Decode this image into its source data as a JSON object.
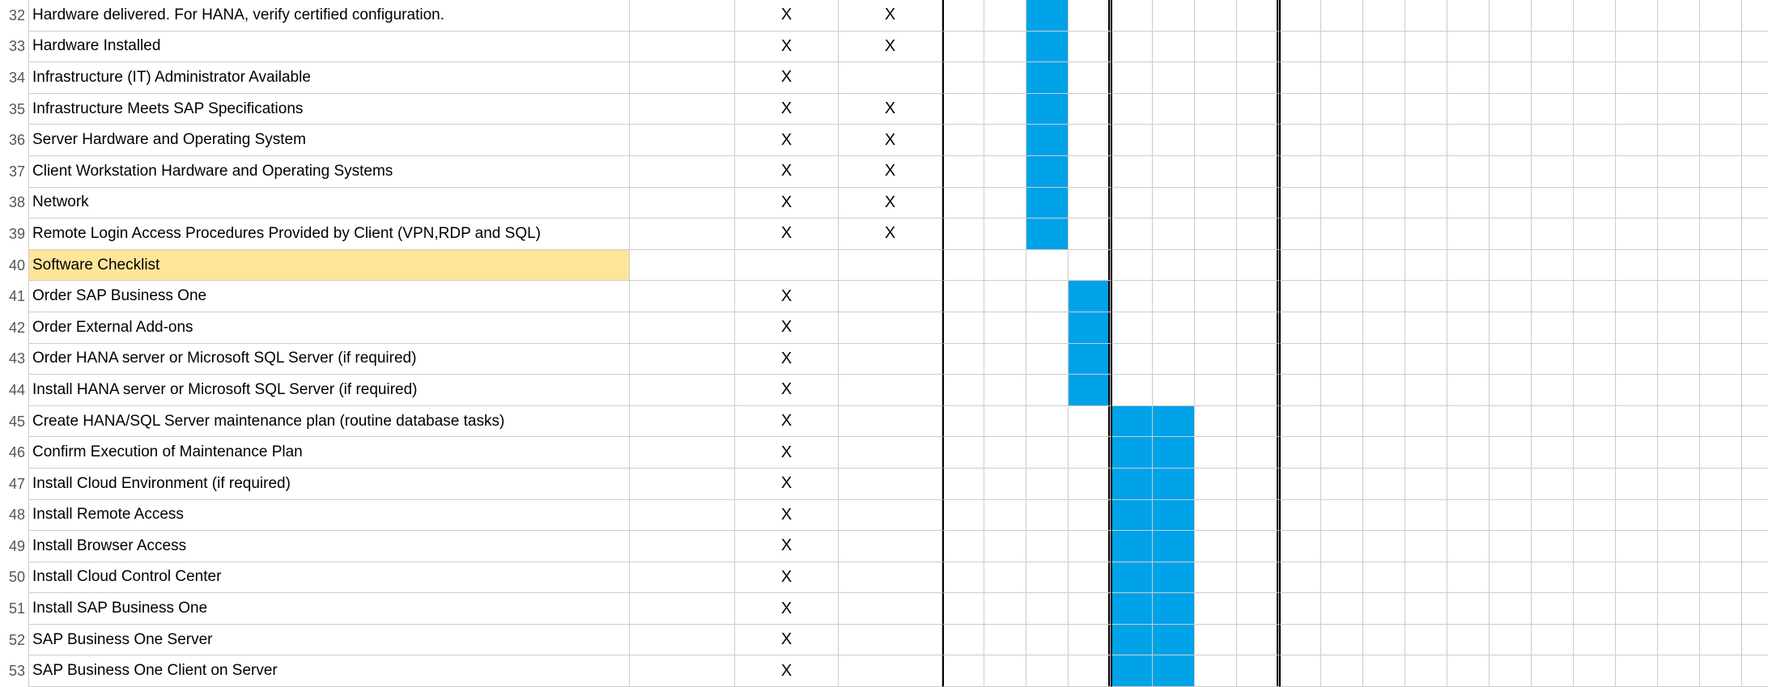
{
  "colors": {
    "accent": "#00a2e8",
    "section_bg": "#ffe599"
  },
  "gantt": {
    "columns": 20,
    "thick_divider_after_cols": [
      0,
      4,
      8
    ]
  },
  "rows": [
    {
      "num": 32,
      "task": "Hardware delivered. For HANA, verify certified configuration.",
      "x1": "X",
      "x2": "X",
      "bars": [
        3
      ]
    },
    {
      "num": 33,
      "task": "Hardware Installed",
      "x1": "X",
      "x2": "X",
      "bars": [
        3
      ]
    },
    {
      "num": 34,
      "task": "Infrastructure (IT) Administrator Available",
      "x1": "X",
      "x2": "",
      "bars": [
        3
      ]
    },
    {
      "num": 35,
      "task": "Infrastructure Meets SAP Specifications",
      "x1": "X",
      "x2": "X",
      "bars": [
        3
      ]
    },
    {
      "num": 36,
      "task": "Server Hardware and Operating System",
      "x1": "X",
      "x2": "X",
      "bars": [
        3
      ]
    },
    {
      "num": 37,
      "task": "Client Workstation Hardware and Operating Systems",
      "x1": "X",
      "x2": "X",
      "bars": [
        3
      ]
    },
    {
      "num": 38,
      "task": "Network",
      "x1": "X",
      "x2": "X",
      "bars": [
        3
      ]
    },
    {
      "num": 39,
      "task": "Remote Login Access Procedures Provided by Client (VPN,RDP and SQL)",
      "x1": "X",
      "x2": "X",
      "bars": [
        3
      ]
    },
    {
      "num": 40,
      "task": "Software Checklist",
      "x1": "",
      "x2": "",
      "bars": [],
      "section": true
    },
    {
      "num": 41,
      "task": "Order SAP Business One",
      "x1": "X",
      "x2": "",
      "bars": [
        4
      ]
    },
    {
      "num": 42,
      "task": "Order External Add-ons",
      "x1": "X",
      "x2": "",
      "bars": [
        4
      ]
    },
    {
      "num": 43,
      "task": "Order HANA server or Microsoft SQL Server (if required)",
      "x1": "X",
      "x2": "",
      "bars": [
        4
      ]
    },
    {
      "num": 44,
      "task": "Install HANA server or Microsoft SQL  Server (if required)",
      "x1": "X",
      "x2": "",
      "bars": [
        4
      ]
    },
    {
      "num": 45,
      "task": "Create HANA/SQL Server maintenance plan (routine database tasks)",
      "x1": "X",
      "x2": "",
      "bars": [
        5,
        6
      ]
    },
    {
      "num": 46,
      "task": "Confirm Execution of Maintenance Plan",
      "x1": "X",
      "x2": "",
      "bars": [
        5,
        6
      ]
    },
    {
      "num": 47,
      "task": "Install Cloud Environment (if required)",
      "x1": "X",
      "x2": "",
      "bars": [
        5,
        6
      ]
    },
    {
      "num": 48,
      "task": "Install Remote Access",
      "x1": "X",
      "x2": "",
      "bars": [
        5,
        6
      ]
    },
    {
      "num": 49,
      "task": "Install Browser Access",
      "x1": "X",
      "x2": "",
      "bars": [
        5,
        6
      ]
    },
    {
      "num": 50,
      "task": "Install Cloud Control Center",
      "x1": "X",
      "x2": "",
      "bars": [
        5,
        6
      ]
    },
    {
      "num": 51,
      "task": "Install SAP Business One",
      "x1": "X",
      "x2": "",
      "bars": [
        5,
        6
      ]
    },
    {
      "num": 52,
      "task": "SAP Business One Server",
      "x1": "X",
      "x2": "",
      "bars": [
        5,
        6
      ]
    },
    {
      "num": 53,
      "task": "SAP Business One Client on Server",
      "x1": "X",
      "x2": "",
      "bars": [
        5,
        6
      ]
    }
  ]
}
